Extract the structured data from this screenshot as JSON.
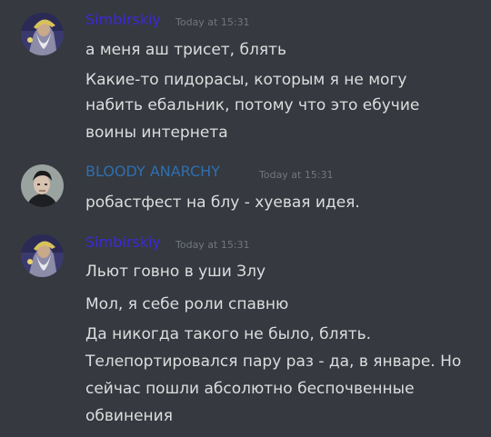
{
  "colors": {
    "background": "#36393f",
    "username_simbirskiy": "#3a2ad8",
    "username_bloody": "#2f6fb0",
    "timestamp": "#72767d",
    "message_text": "#dcddde"
  },
  "messages": [
    {
      "username": "Simbirskiy",
      "timestamp": "Today at 15:31",
      "avatar": "wizard-avatar-icon",
      "lines": [
        "а меня аш трисет, блять",
        "Какие-то пидорасы, которым я не могу",
        "набить ебальник, потому что это ебучие",
        "воины интернета"
      ]
    },
    {
      "username": "BLOODY ANARCHY",
      "timestamp": "Today at 15:31",
      "avatar": "man-portrait-avatar-icon",
      "lines": [
        "робастфест на блу - хуевая идея."
      ]
    },
    {
      "username": "Simbirskiy",
      "timestamp": "Today at 15:31",
      "avatar": "wizard-avatar-icon",
      "lines": [
        "Льют говно в уши Злу",
        "Мол, я себе роли спавню",
        "Да никогда такого не было, блять.",
        "Телепортировался пару раз - да, в январе. Но",
        "сейчас пошли абсолютно беспочвенные",
        "обвинения"
      ]
    }
  ]
}
